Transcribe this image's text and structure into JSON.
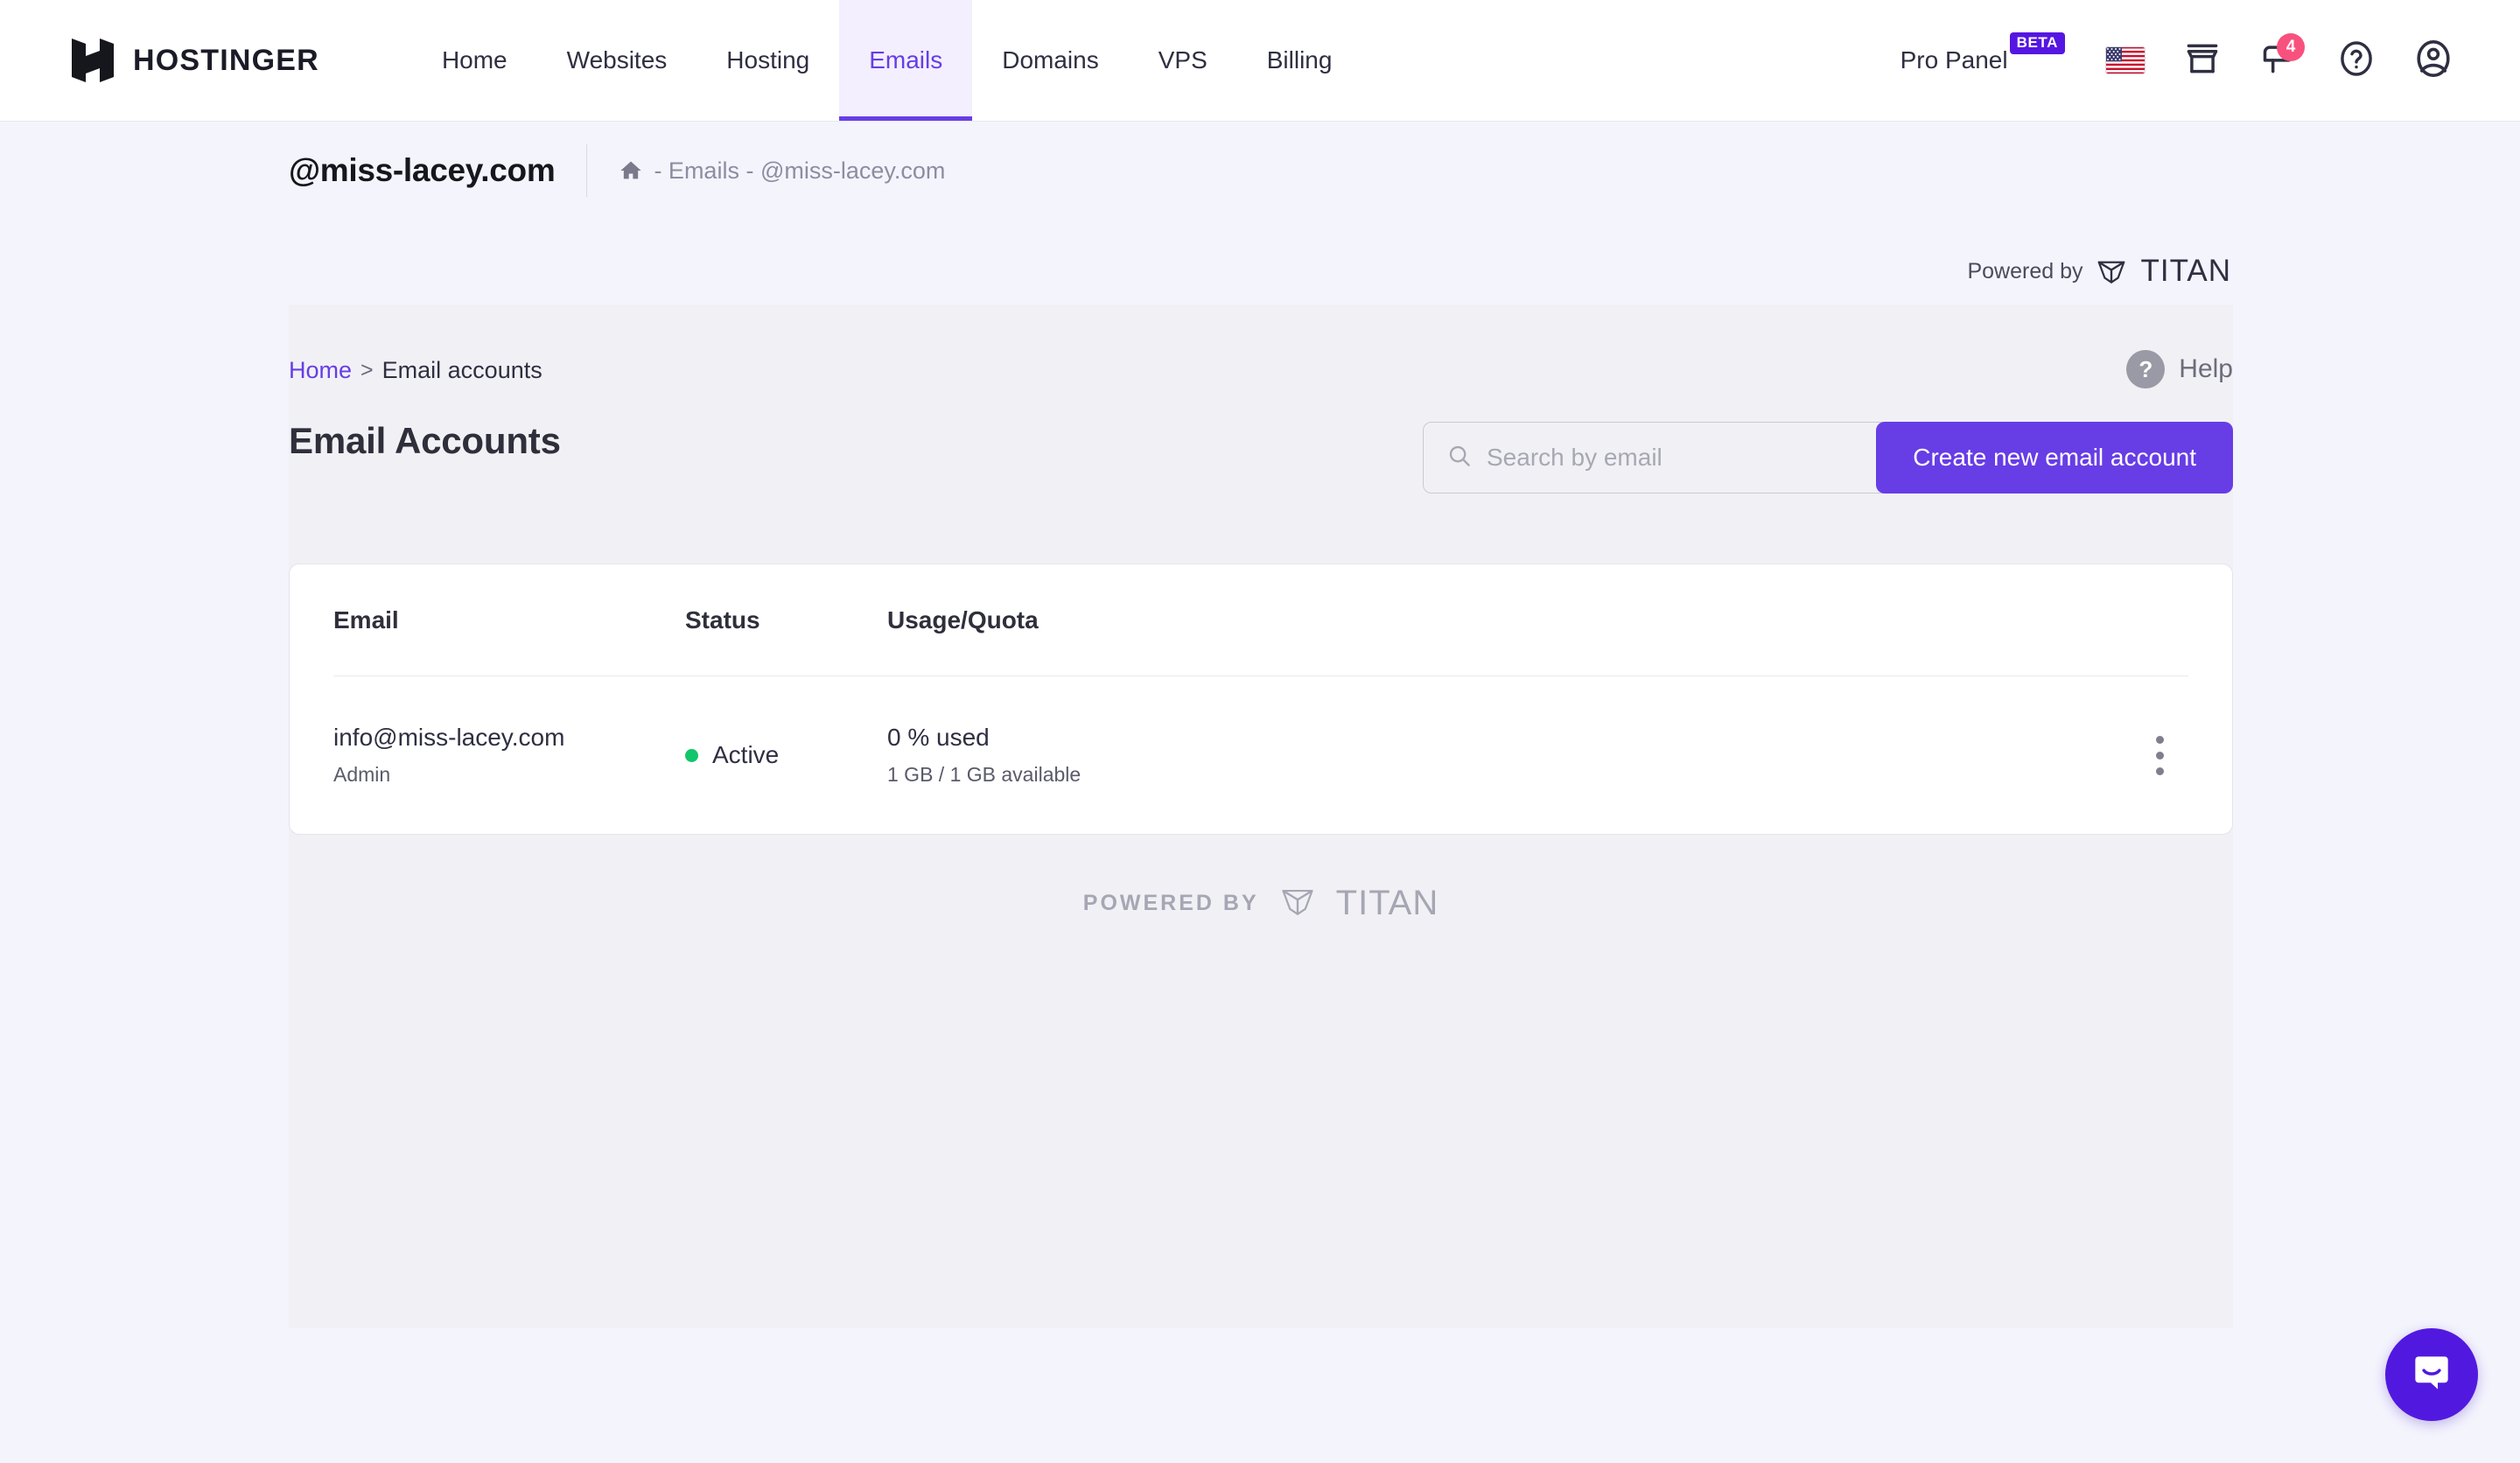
{
  "brand": {
    "name": "HOSTINGER",
    "logo_icon": "hostinger-h-logo"
  },
  "nav": {
    "items": [
      {
        "label": "Home",
        "active": false
      },
      {
        "label": "Websites",
        "active": false
      },
      {
        "label": "Hosting",
        "active": false
      },
      {
        "label": "Emails",
        "active": true
      },
      {
        "label": "Domains",
        "active": false
      },
      {
        "label": "VPS",
        "active": false
      },
      {
        "label": "Billing",
        "active": false
      }
    ]
  },
  "topright": {
    "pro_panel_label": "Pro Panel",
    "beta_badge": "BETA",
    "flag_icon": "us-flag-icon",
    "marketplace_icon": "store-icon",
    "notifications_icon": "mailbox-icon",
    "notifications_count": "4",
    "help_icon": "question-circle-icon",
    "account_icon": "user-avatar-icon"
  },
  "domain_header": {
    "title": "@miss-lacey.com",
    "home_icon": "home-icon",
    "breadcrumb": "- Emails - @miss-lacey.com"
  },
  "powered_top": {
    "text": "Powered by",
    "brand": "TITAN",
    "icon": "titan-cube-icon"
  },
  "panel": {
    "breadcrumb": {
      "home": "Home",
      "separator": ">",
      "current": "Email accounts"
    },
    "help": {
      "icon": "question-mark-icon",
      "label": "Help"
    },
    "page_title": "Email Accounts",
    "search": {
      "placeholder": "Search by email",
      "value": "",
      "icon": "search-icon"
    },
    "create_button": "Create new email account"
  },
  "table": {
    "columns": [
      "Email",
      "Status",
      "Usage/Quota"
    ],
    "rows": [
      {
        "email": "info@miss-lacey.com",
        "role": "Admin",
        "status": "Active",
        "status_color": "#13c56b",
        "usage_percent": "0 % used",
        "usage_detail": "1 GB / 1 GB available",
        "menu_icon": "kebab-menu-icon"
      }
    ]
  },
  "powered_footer": {
    "text": "POWERED BY",
    "brand": "TITAN",
    "icon": "titan-cube-icon"
  },
  "chat": {
    "icon": "chat-bubble-icon"
  },
  "colors": {
    "accent": "#673de6",
    "beta_badge_bg": "#5516e2",
    "notification_badge": "#f8517e",
    "status_active": "#13c56b",
    "page_bg": "#f4f4fd",
    "panel_bg": "#f1f1f5",
    "card_bg": "#ffffff"
  }
}
